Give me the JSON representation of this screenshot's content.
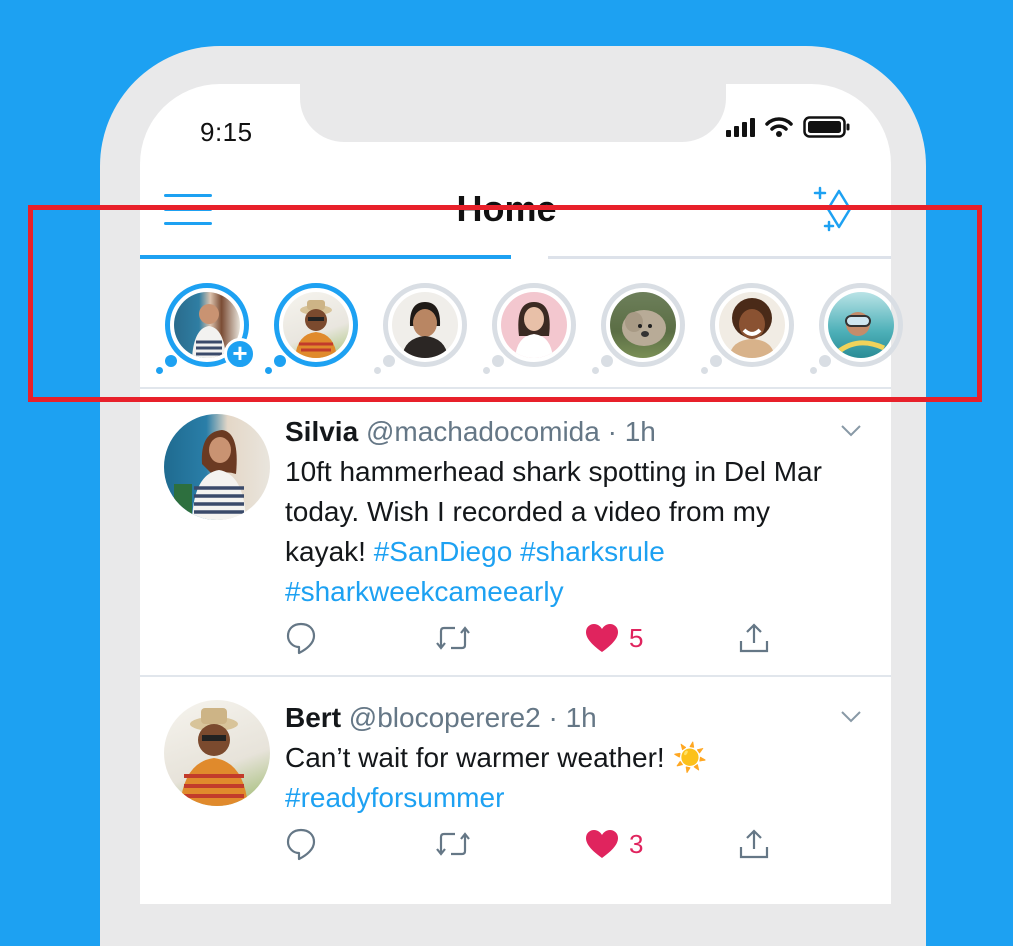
{
  "status_bar": {
    "time": "9:15"
  },
  "header": {
    "title": "Home"
  },
  "colors": {
    "accent": "#1da1f2",
    "like": "#e0245e",
    "highlight": "#e8202a"
  },
  "fleets": [
    {
      "name": "your-fleet",
      "state": "active",
      "has_add_badge": true
    },
    {
      "name": "bert",
      "state": "active"
    },
    {
      "name": "user-3",
      "state": "seen"
    },
    {
      "name": "user-4",
      "state": "seen"
    },
    {
      "name": "dog",
      "state": "seen"
    },
    {
      "name": "user-6",
      "state": "seen"
    },
    {
      "name": "diver",
      "state": "seen"
    }
  ],
  "fleet_add_symbol": "+",
  "tweets": [
    {
      "name": "Silvia",
      "handle": "@machadocomida",
      "time": "1h",
      "text": "10ft hammerhead shark spotting in Del Mar today. Wish I recorded a video from my kayak!",
      "hashtags": [
        "#SanDiego",
        "#sharksrule",
        "#sharkweekcameearly"
      ],
      "likes": "5",
      "liked": true
    },
    {
      "name": "Bert",
      "handle": "@blocoperere2",
      "time": "1h",
      "text": "Can’t wait for warmer weather! ☀️",
      "hashtags": [
        "#readyforsummer"
      ],
      "likes": "3",
      "liked": true
    }
  ],
  "separator": " · "
}
